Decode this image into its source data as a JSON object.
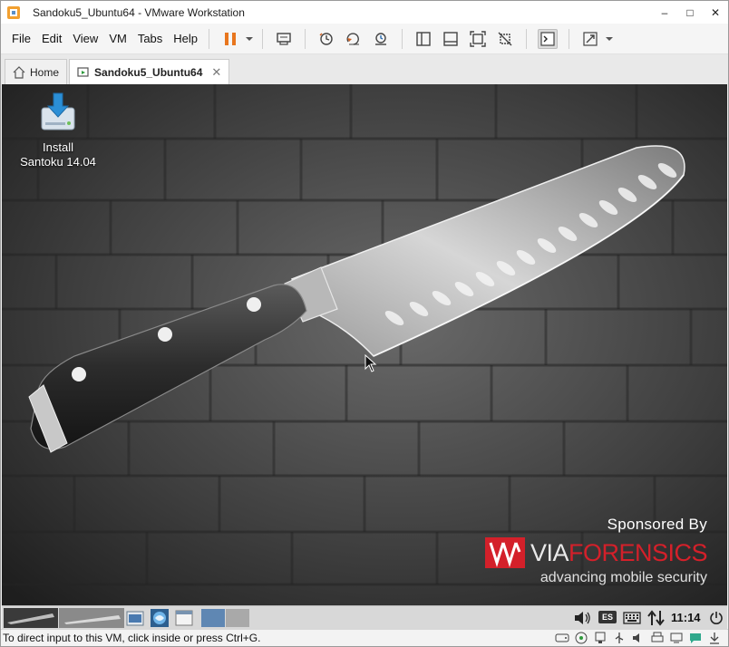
{
  "window": {
    "title": "Sandoku5_Ubuntu64 - VMware Workstation",
    "minimize": "–",
    "maximize": "□",
    "close": "✕"
  },
  "menu": {
    "items": [
      "File",
      "Edit",
      "View",
      "VM",
      "Tabs",
      "Help"
    ]
  },
  "toolbar": {
    "icons": [
      "pause-icon",
      "dropdown-icon",
      "send-ctrl-alt-del-icon",
      "snapshot-icon",
      "revert-snapshot-icon",
      "snapshot-manager-icon",
      "show-library-icon",
      "thumbnail-bar-icon",
      "full-screen-icon",
      "unity-icon",
      "console-view-icon",
      "stretch-icon",
      "stretch-dropdown-icon"
    ]
  },
  "tabs": [
    {
      "label": "Home",
      "active": false
    },
    {
      "label": "Sandoku5_Ubuntu64",
      "active": true,
      "close": "✕"
    }
  ],
  "desktop": {
    "icon_label_line1": "Install",
    "icon_label_line2": "Santoku 14.04",
    "sponsored_by": "Sponsored By",
    "brand_part1": "VIA",
    "brand_part2": "FORENSICS",
    "tagline": "advancing mobile security"
  },
  "panel": {
    "keyboard_layout": "ES",
    "clock": "11:14"
  },
  "statusbar": {
    "text": "To direct input to this VM, click inside or press Ctrl+G."
  },
  "colors": {
    "accent_pause": "#e8761e",
    "brand_red": "#d4202a"
  }
}
